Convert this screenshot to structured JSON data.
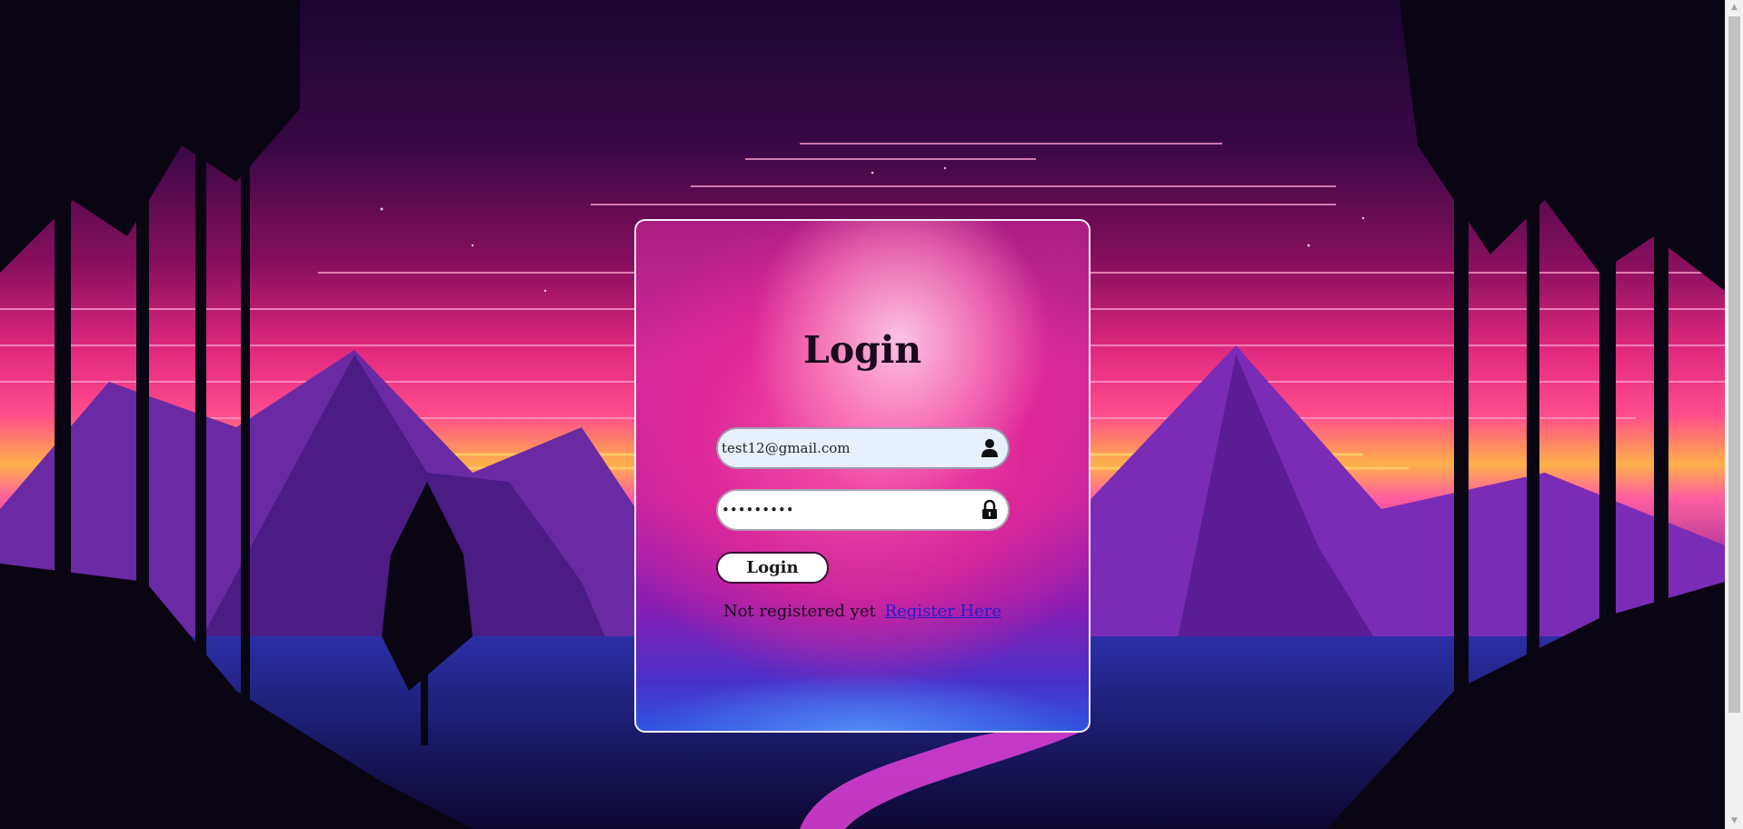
{
  "page": {
    "title": "Login"
  },
  "form": {
    "email_value": "test12@gmail.com",
    "password_value": "•••••••••",
    "submit_label": "Login",
    "register_prompt": "Not registered yet",
    "register_link": "Register Here"
  },
  "icons": {
    "email": "user-icon",
    "password": "lock-icon"
  },
  "colors": {
    "card_border": "#ffffff",
    "link": "#2a1bd0",
    "email_field_bg": "#e8f0fe"
  }
}
